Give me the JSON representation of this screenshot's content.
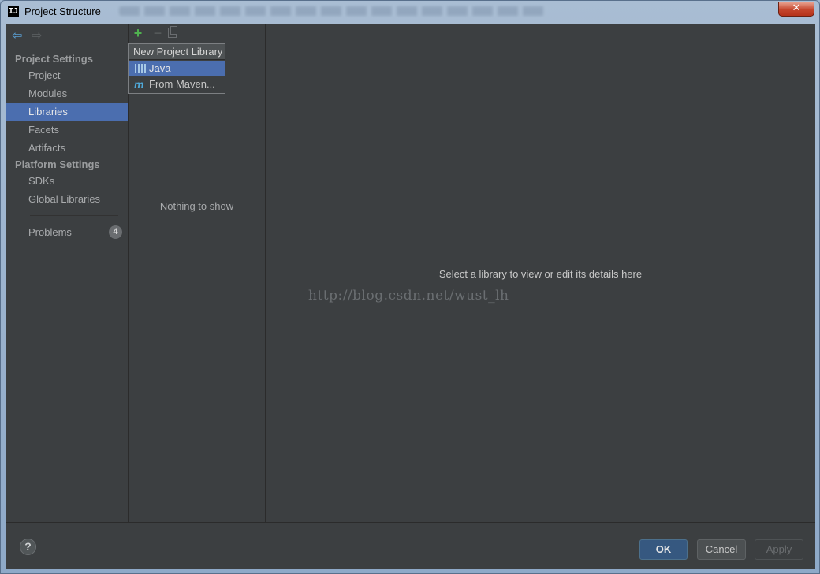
{
  "window": {
    "title": "Project Structure",
    "app_icon_text": "IJ",
    "close_label": "✕"
  },
  "nav": {
    "back_icon": "back-arrow-icon",
    "forward_icon": "forward-arrow-icon"
  },
  "sidebar": {
    "project_settings_header": "Project Settings",
    "project_items": [
      {
        "label": "Project"
      },
      {
        "label": "Modules"
      },
      {
        "label": "Libraries",
        "selected": true
      },
      {
        "label": "Facets"
      },
      {
        "label": "Artifacts"
      }
    ],
    "platform_settings_header": "Platform Settings",
    "platform_items": [
      {
        "label": "SDKs"
      },
      {
        "label": "Global Libraries"
      }
    ],
    "problems": {
      "label": "Problems",
      "count": "4"
    }
  },
  "libraries": {
    "toolbar": {
      "add": "+",
      "remove": "−"
    },
    "empty_text": "Nothing to show"
  },
  "popup": {
    "title": "New Project Library",
    "items": [
      {
        "label": "Java",
        "icon": "java-library-icon"
      },
      {
        "label": "From Maven...",
        "icon": "maven-icon"
      }
    ]
  },
  "details": {
    "placeholder": "Select a library to view or edit its details here",
    "watermark": "http://blog.csdn.net/wust_lh"
  },
  "footer": {
    "help": "?",
    "ok": "OK",
    "cancel": "Cancel",
    "apply": "Apply"
  },
  "colors": {
    "selection": "#4b6eaf",
    "background": "#3c3f41",
    "add_green": "#4fb24f"
  }
}
